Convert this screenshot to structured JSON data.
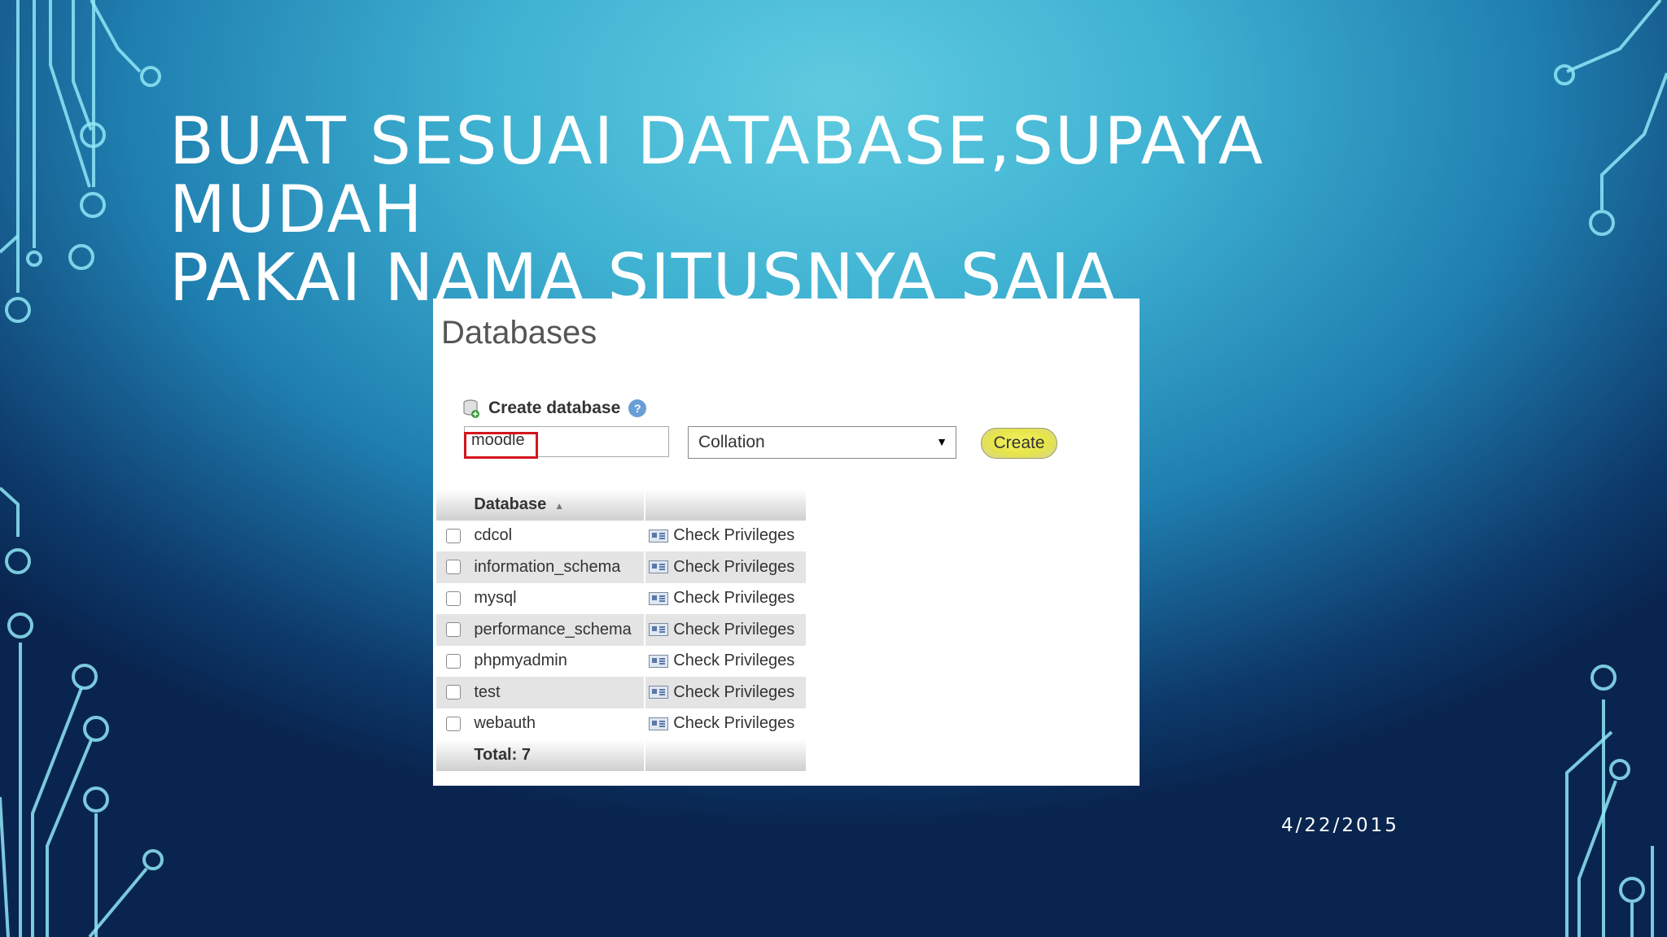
{
  "slide": {
    "title_lines": [
      "BUAT SESUAI DATABASE,SUPAYA MUDAH",
      "PAKAI NAMA SITUSNYA SAJA"
    ],
    "date": "4/22/2015"
  },
  "panel": {
    "heading": "Databases",
    "create_label": "Create database",
    "help_glyph": "?",
    "name_value": "moodle",
    "collation_label": "Collation",
    "dropdown_glyph": "▼",
    "create_button": "Create",
    "table": {
      "header": "Database",
      "sort_glyph": "▲",
      "rows": [
        {
          "name": "cdcol",
          "action": "Check Privileges"
        },
        {
          "name": "information_schema",
          "action": "Check Privileges"
        },
        {
          "name": "mysql",
          "action": "Check Privileges"
        },
        {
          "name": "performance_schema",
          "action": "Check Privileges"
        },
        {
          "name": "phpmyadmin",
          "action": "Check Privileges"
        },
        {
          "name": "test",
          "action": "Check Privileges"
        },
        {
          "name": "webauth",
          "action": "Check Privileges"
        }
      ],
      "total": "Total: 7"
    },
    "icons": {
      "create": "database-add-icon",
      "help": "help-icon",
      "privileges": "check-privileges-icon"
    },
    "colors": {
      "highlight_border": "#d4141c",
      "button_fill": "#e6e44a",
      "alt_row": "#e4e4e4"
    }
  }
}
